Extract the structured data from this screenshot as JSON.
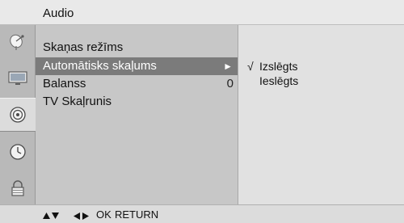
{
  "header": {
    "title": "Audio"
  },
  "icon_strip": [
    {
      "icon": "satellite-dish-icon",
      "active": false
    },
    {
      "icon": "monitor-icon",
      "active": false
    },
    {
      "icon": "speaker-icon",
      "active": true
    },
    {
      "icon": "clock-icon",
      "active": false
    },
    {
      "icon": "lock-icon",
      "active": false
    }
  ],
  "menu": {
    "items": [
      {
        "label": "Skaņas režīms",
        "value": "",
        "selected": false
      },
      {
        "label": "Automātisks skaļums",
        "value": "",
        "selected": true,
        "arrow": "►"
      },
      {
        "label": "Balanss",
        "value": "0",
        "selected": false
      },
      {
        "label": "TV Skaļrunis",
        "value": "",
        "selected": false
      }
    ]
  },
  "submenu": {
    "options": [
      {
        "label": "Izslēgts",
        "checked": true,
        "check_mark": "√"
      },
      {
        "label": "Ieslēgts",
        "checked": false,
        "check_mark": ""
      }
    ]
  },
  "help_bar": {
    "ok_label": "OK",
    "return_label": "RETURN"
  },
  "colors": {
    "menu_bg": "#c7c7c7",
    "menu_selected_bg": "#7b7b7b",
    "submenu_bg": "#e1e1e1",
    "icon_strip_bg": "#b9b9b9"
  }
}
